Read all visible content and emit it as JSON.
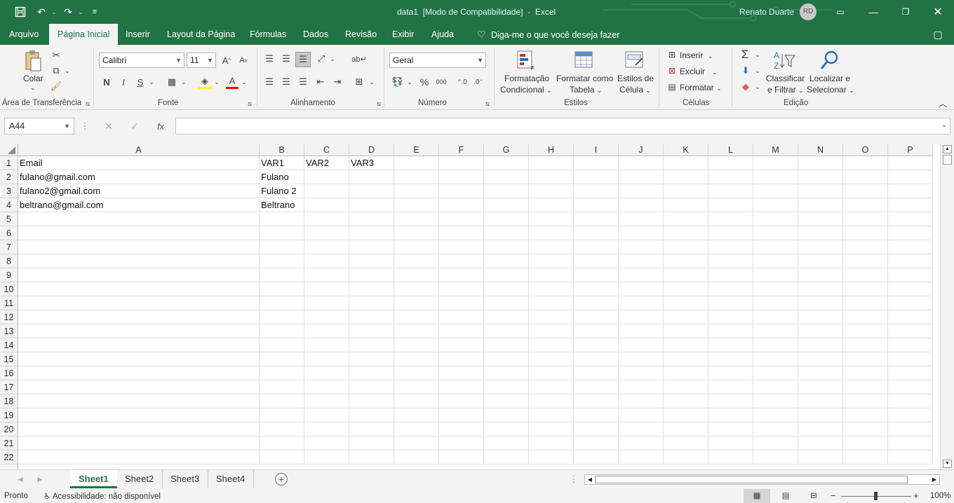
{
  "window": {
    "file_name": "data1",
    "mode": "[Modo de Compatibilidade]",
    "app": "Excel",
    "user_name": "Renato Duarte",
    "user_initials": "RD"
  },
  "ribbon_tabs": [
    "Arquivo",
    "Página Inicial",
    "Inserir",
    "Layout da Página",
    "Fórmulas",
    "Dados",
    "Revisão",
    "Exibir",
    "Ajuda"
  ],
  "tell_me": "Diga-me o que você deseja fazer",
  "clipboard": {
    "paste_label": "Colar",
    "group_label": "Área de Transferência"
  },
  "font": {
    "name": "Calibri",
    "size": "11",
    "bold": "N",
    "italic": "I",
    "underline": "S",
    "group_label": "Fonte"
  },
  "alignment": {
    "group_label": "Alinhamento"
  },
  "number": {
    "format": "Geral",
    "percent": "%",
    "thousands": "000",
    "group_label": "Número"
  },
  "styles": {
    "conditional_l1": "Formatação",
    "conditional_l2": "Condicional",
    "table_l1": "Formatar como",
    "table_l2": "Tabela",
    "cell_l1": "Estilos de",
    "cell_l2": "Célula",
    "group_label": "Estilos"
  },
  "cells_group": {
    "insert": "Inserir",
    "delete": "Excluir",
    "format": "Formatar",
    "group_label": "Células"
  },
  "editing": {
    "sort_l1": "Classificar",
    "sort_l2": "e Filtrar",
    "find_l1": "Localizar e",
    "find_l2": "Selecionar",
    "group_label": "Edição"
  },
  "formula_bar": {
    "name_box": "A44",
    "fx": "fx",
    "formula": ""
  },
  "grid": {
    "columns": [
      "A",
      "B",
      "C",
      "D",
      "E",
      "F",
      "G",
      "H",
      "I",
      "J",
      "K",
      "L",
      "M",
      "N",
      "O",
      "P"
    ],
    "rows": [
      "1",
      "2",
      "3",
      "4",
      "5",
      "6",
      "7",
      "8",
      "9",
      "10",
      "11",
      "12",
      "13",
      "14",
      "15",
      "16",
      "17",
      "18",
      "19",
      "20",
      "21",
      "22"
    ],
    "data": [
      [
        "Email",
        "VAR1",
        "VAR2",
        "VAR3"
      ],
      [
        "fulano@gmail.com",
        "Fulano",
        "",
        ""
      ],
      [
        "fulano2@gmail.com",
        "Fulano 2",
        "",
        ""
      ],
      [
        "beltrano@gmail.com",
        "Beltrano",
        "",
        ""
      ]
    ]
  },
  "sheets": [
    "Sheet1",
    "Sheet2",
    "Sheet3",
    "Sheet4"
  ],
  "active_sheet": "Sheet1",
  "status": {
    "ready": "Pronto",
    "accessibility": "Acessibilidade: não disponível",
    "zoom": "100%"
  }
}
